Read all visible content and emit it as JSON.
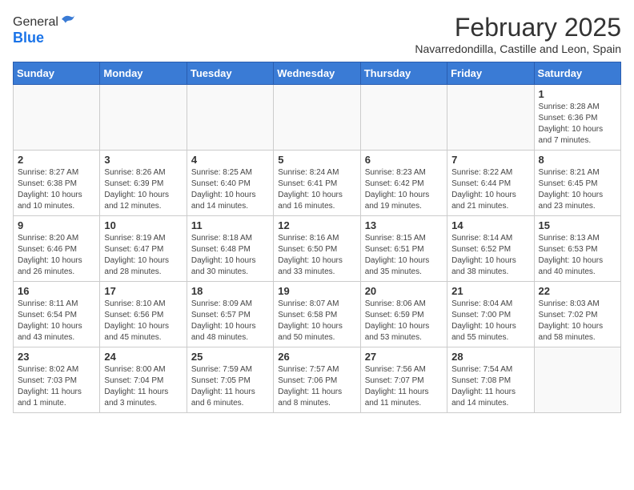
{
  "header": {
    "logo_general": "General",
    "logo_blue": "Blue",
    "month_title": "February 2025",
    "subtitle": "Navarredondilla, Castille and Leon, Spain"
  },
  "weekdays": [
    "Sunday",
    "Monday",
    "Tuesday",
    "Wednesday",
    "Thursday",
    "Friday",
    "Saturday"
  ],
  "weeks": [
    [
      {
        "day": "",
        "info": ""
      },
      {
        "day": "",
        "info": ""
      },
      {
        "day": "",
        "info": ""
      },
      {
        "day": "",
        "info": ""
      },
      {
        "day": "",
        "info": ""
      },
      {
        "day": "",
        "info": ""
      },
      {
        "day": "1",
        "info": "Sunrise: 8:28 AM\nSunset: 6:36 PM\nDaylight: 10 hours and 7 minutes."
      }
    ],
    [
      {
        "day": "2",
        "info": "Sunrise: 8:27 AM\nSunset: 6:38 PM\nDaylight: 10 hours and 10 minutes."
      },
      {
        "day": "3",
        "info": "Sunrise: 8:26 AM\nSunset: 6:39 PM\nDaylight: 10 hours and 12 minutes."
      },
      {
        "day": "4",
        "info": "Sunrise: 8:25 AM\nSunset: 6:40 PM\nDaylight: 10 hours and 14 minutes."
      },
      {
        "day": "5",
        "info": "Sunrise: 8:24 AM\nSunset: 6:41 PM\nDaylight: 10 hours and 16 minutes."
      },
      {
        "day": "6",
        "info": "Sunrise: 8:23 AM\nSunset: 6:42 PM\nDaylight: 10 hours and 19 minutes."
      },
      {
        "day": "7",
        "info": "Sunrise: 8:22 AM\nSunset: 6:44 PM\nDaylight: 10 hours and 21 minutes."
      },
      {
        "day": "8",
        "info": "Sunrise: 8:21 AM\nSunset: 6:45 PM\nDaylight: 10 hours and 23 minutes."
      }
    ],
    [
      {
        "day": "9",
        "info": "Sunrise: 8:20 AM\nSunset: 6:46 PM\nDaylight: 10 hours and 26 minutes."
      },
      {
        "day": "10",
        "info": "Sunrise: 8:19 AM\nSunset: 6:47 PM\nDaylight: 10 hours and 28 minutes."
      },
      {
        "day": "11",
        "info": "Sunrise: 8:18 AM\nSunset: 6:48 PM\nDaylight: 10 hours and 30 minutes."
      },
      {
        "day": "12",
        "info": "Sunrise: 8:16 AM\nSunset: 6:50 PM\nDaylight: 10 hours and 33 minutes."
      },
      {
        "day": "13",
        "info": "Sunrise: 8:15 AM\nSunset: 6:51 PM\nDaylight: 10 hours and 35 minutes."
      },
      {
        "day": "14",
        "info": "Sunrise: 8:14 AM\nSunset: 6:52 PM\nDaylight: 10 hours and 38 minutes."
      },
      {
        "day": "15",
        "info": "Sunrise: 8:13 AM\nSunset: 6:53 PM\nDaylight: 10 hours and 40 minutes."
      }
    ],
    [
      {
        "day": "16",
        "info": "Sunrise: 8:11 AM\nSunset: 6:54 PM\nDaylight: 10 hours and 43 minutes."
      },
      {
        "day": "17",
        "info": "Sunrise: 8:10 AM\nSunset: 6:56 PM\nDaylight: 10 hours and 45 minutes."
      },
      {
        "day": "18",
        "info": "Sunrise: 8:09 AM\nSunset: 6:57 PM\nDaylight: 10 hours and 48 minutes."
      },
      {
        "day": "19",
        "info": "Sunrise: 8:07 AM\nSunset: 6:58 PM\nDaylight: 10 hours and 50 minutes."
      },
      {
        "day": "20",
        "info": "Sunrise: 8:06 AM\nSunset: 6:59 PM\nDaylight: 10 hours and 53 minutes."
      },
      {
        "day": "21",
        "info": "Sunrise: 8:04 AM\nSunset: 7:00 PM\nDaylight: 10 hours and 55 minutes."
      },
      {
        "day": "22",
        "info": "Sunrise: 8:03 AM\nSunset: 7:02 PM\nDaylight: 10 hours and 58 minutes."
      }
    ],
    [
      {
        "day": "23",
        "info": "Sunrise: 8:02 AM\nSunset: 7:03 PM\nDaylight: 11 hours and 1 minute."
      },
      {
        "day": "24",
        "info": "Sunrise: 8:00 AM\nSunset: 7:04 PM\nDaylight: 11 hours and 3 minutes."
      },
      {
        "day": "25",
        "info": "Sunrise: 7:59 AM\nSunset: 7:05 PM\nDaylight: 11 hours and 6 minutes."
      },
      {
        "day": "26",
        "info": "Sunrise: 7:57 AM\nSunset: 7:06 PM\nDaylight: 11 hours and 8 minutes."
      },
      {
        "day": "27",
        "info": "Sunrise: 7:56 AM\nSunset: 7:07 PM\nDaylight: 11 hours and 11 minutes."
      },
      {
        "day": "28",
        "info": "Sunrise: 7:54 AM\nSunset: 7:08 PM\nDaylight: 11 hours and 14 minutes."
      },
      {
        "day": "",
        "info": ""
      }
    ]
  ]
}
